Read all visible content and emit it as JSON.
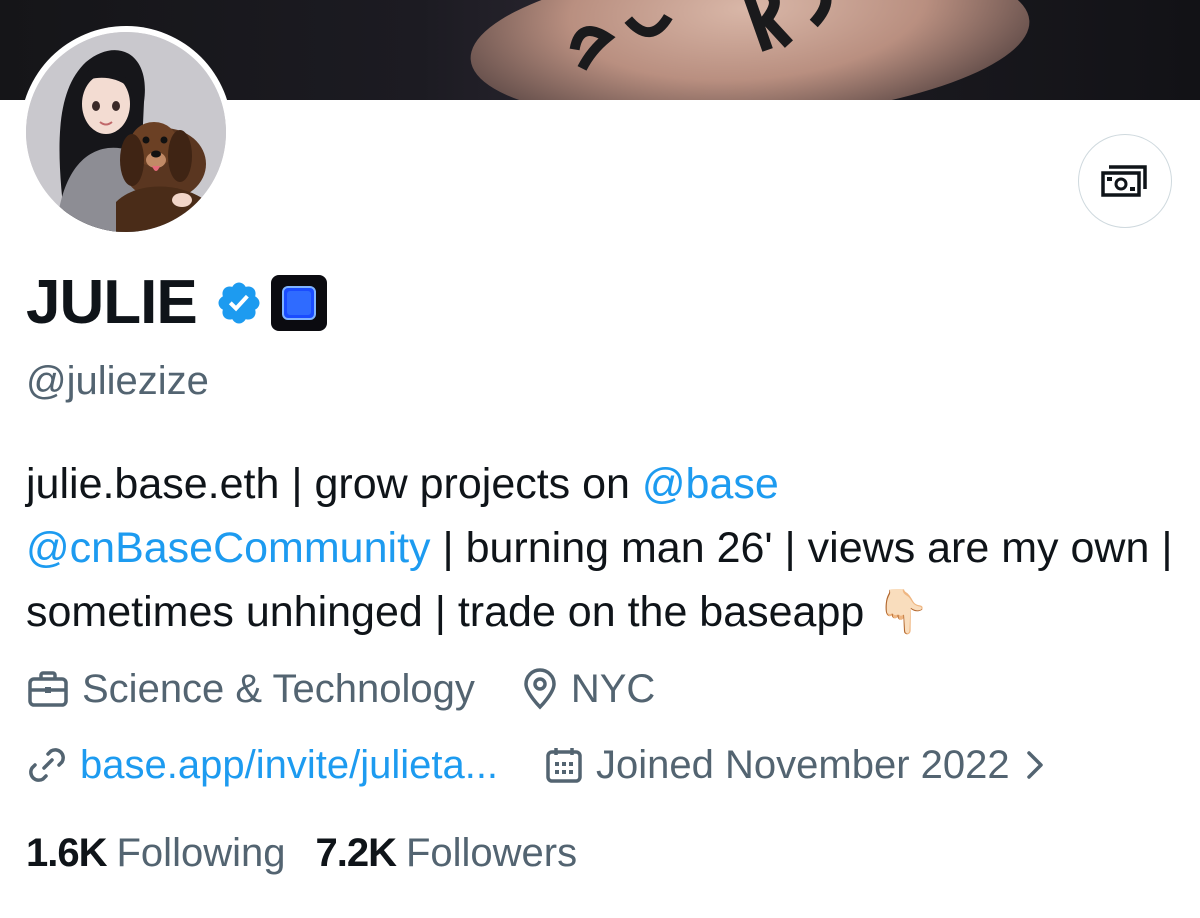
{
  "banner": {
    "image": "tattooed-hand-photo"
  },
  "avatar": {
    "image": "anime-girl-with-dachshund"
  },
  "profile": {
    "name": "JULIE",
    "verified_icon": "verified-badge-icon",
    "affiliate_icon": "blue-square-badge-icon",
    "handle": "@juliezize"
  },
  "tip_button": {
    "icon": "money-tip-icon"
  },
  "bio": {
    "part1": "julie.base.eth | grow projects on ",
    "mention1": "@base",
    "mention2": "@cnBaseCommunity",
    "part2": " | burning man 26' | views are my own | sometimes unhinged | trade on the baseapp ",
    "emoji": "👇🏻"
  },
  "meta": {
    "category": "Science & Technology",
    "location": "NYC",
    "website": "base.app/invite/julieta...",
    "joined": "Joined November 2022"
  },
  "stats": {
    "following_count": "1.6K",
    "following_label": "Following",
    "followers_count": "7.2K",
    "followers_label": "Followers"
  },
  "colors": {
    "accent": "#1d9bf0",
    "secondary_text": "#536471",
    "primary_text": "#0f1419"
  }
}
